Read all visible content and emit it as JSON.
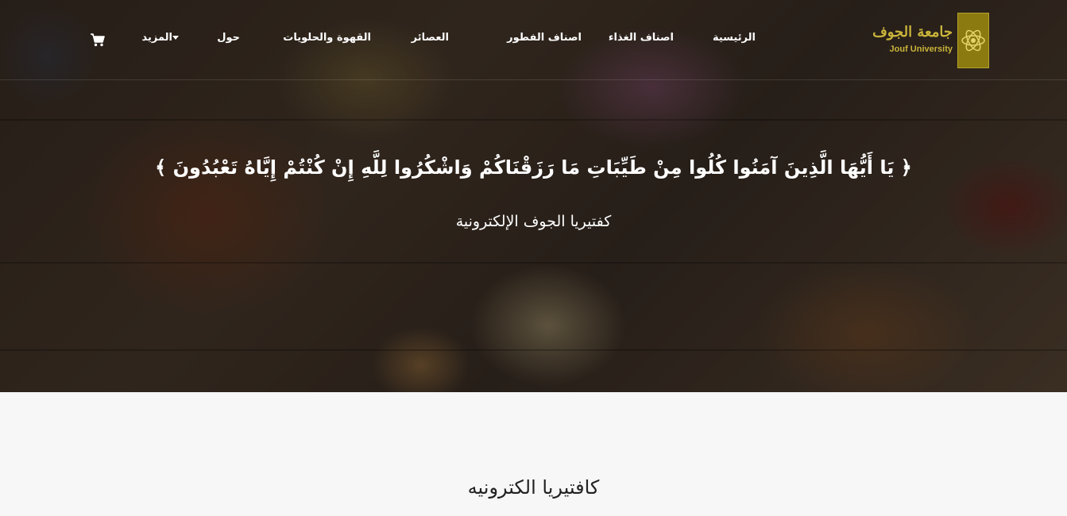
{
  "logo": {
    "text_ar": "جامعة الجوف",
    "text_en": "Jouf University"
  },
  "nav": {
    "home": "الرئيسية",
    "meals": "اصناف الغذاء",
    "breakfast": "اصناف الفطور",
    "juices": "العصائر",
    "coffee_sweets": "القهوة والحلويات",
    "about": "حول",
    "more": "المزيد"
  },
  "icons": {
    "cart": "cart-icon",
    "caret": "caret-down-icon",
    "logo": "jouf-university-atom-logo"
  },
  "hero": {
    "verse": "﴿ يَا أَيُّهَا الَّذِينَ آمَنُوا كُلُوا مِنْ طَيِّبَاتِ مَا رَزَقْنَاكُمْ وَاشْكُرُوا لِلَّهِ إِنْ كُنْتُمْ إِيَّاهُ تَعْبُدُونَ ﴾",
    "subtitle": "كفتيريا الجوف الإلكترونية"
  },
  "section": {
    "title": "كافتيريا الكترونيه"
  },
  "colors": {
    "logo_gold": "#8a7a10",
    "nav_text": "#ffffff",
    "page_bg": "#f7f7f7"
  }
}
